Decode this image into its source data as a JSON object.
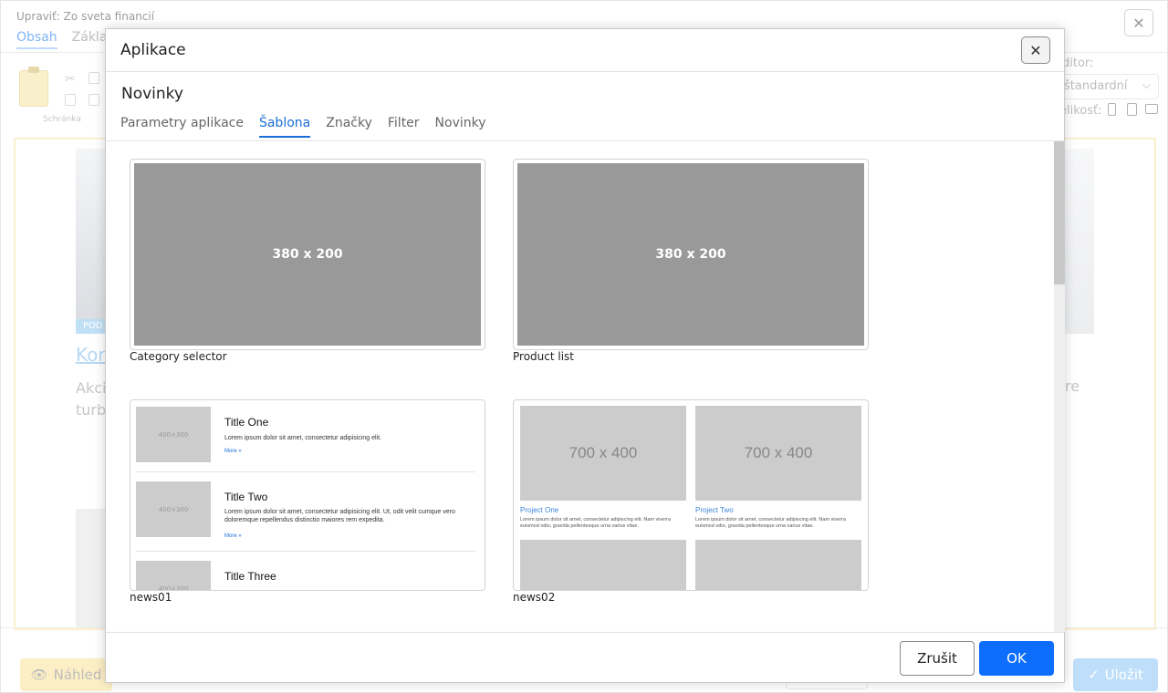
{
  "background": {
    "window_title": "Upraviť: Zo sveta financií",
    "tabs": [
      "Obsah",
      "Základ"
    ],
    "clipboard_label": "Schránka",
    "editor_label": "ditor:",
    "editor_select": "štandardní",
    "size_label": "elikosť:",
    "pod_badge": "POD",
    "link_text": "Kon",
    "para_left_1": "Akci",
    "para_left_2": "turbu",
    "para_right": "re",
    "preview_button": "Náhled",
    "save_button": "Uložit"
  },
  "modal": {
    "title": "Aplikace",
    "app_name": "Novinky",
    "tabs": [
      "Parametry aplikace",
      "Šablona",
      "Značky",
      "Filter",
      "Novinky"
    ],
    "active_tab": "Šablona",
    "cancel_button": "Zrušit",
    "ok_button": "OK"
  },
  "templates": [
    {
      "label": "Category selector",
      "placeholder": "380 x 200"
    },
    {
      "label": "Product list",
      "placeholder": "380 x 200"
    },
    {
      "label": "news01",
      "preview": {
        "image_text": "400×300",
        "items": [
          {
            "title": "Title One",
            "text": "Lorem ipsum dolor sit amet, consectetur adipisicing elit.",
            "more": "More »"
          },
          {
            "title": "Title Two",
            "text": "Lorem ipsum dolor sit amet, consectetur adipisicing elit. Ut, odit velit cumque vero doloremque repellendus distinctio maiores rem expedita.",
            "more": "More »"
          },
          {
            "title": "Title Three",
            "text": "",
            "more": ""
          }
        ]
      }
    },
    {
      "label": "news02",
      "preview": {
        "image_text": "700 x 400",
        "projects": [
          {
            "title": "Project One",
            "text": "Lorem ipsum dolor sit amet, consectetur adipiscing elit. Nam viverra euismod odio, gravida pellentesque urna varius vitae."
          },
          {
            "title": "Project Two",
            "text": "Lorem ipsum dolor sit amet, consectetur adipiscing elit. Nam viverra euismod odio, gravida pellentesque urna varius vitae."
          }
        ]
      }
    }
  ]
}
